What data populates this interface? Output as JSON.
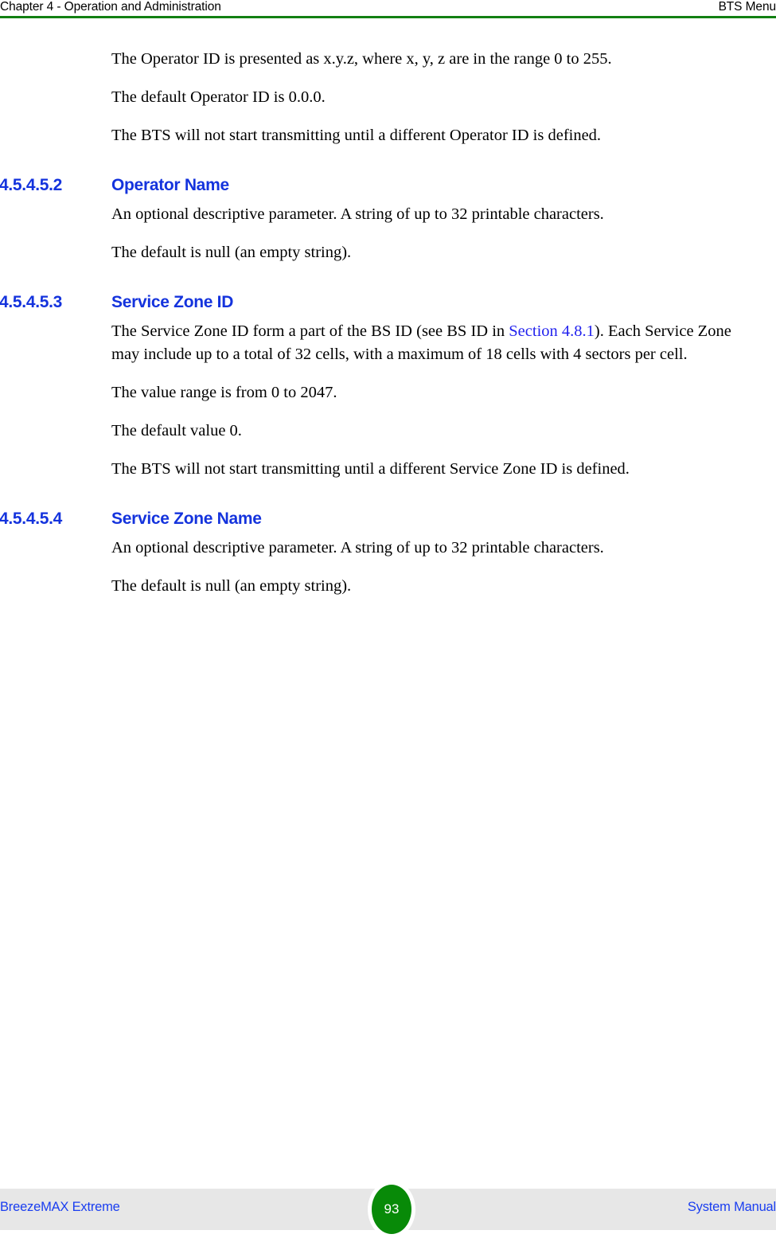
{
  "header": {
    "left": "Chapter 4 - Operation and Administration",
    "right": "BTS Menu",
    "rule_color": "#128012"
  },
  "body": {
    "intro_paragraphs": [
      "The Operator ID is presented as x.y.z, where x, y, z are in the range 0 to 255.",
      "The default Operator ID is 0.0.0.",
      "The BTS will not start transmitting until a different Operator ID is defined."
    ],
    "sections": [
      {
        "number": "4.5.4.5.2",
        "title": "Operator Name",
        "paragraphs": [
          "An optional descriptive parameter. A string of up to 32 printable characters.",
          "The default is null (an empty string)."
        ]
      },
      {
        "number": "4.5.4.5.3",
        "title": "Service Zone ID",
        "paragraph_lead": "The Service Zone ID form a part of the BS ID (see BS ID in ",
        "link_text": "Section 4.8.1",
        "paragraph_tail": "). Each Service Zone may include up to a total of 32 cells, with a maximum of 18 cells with 4 sectors per cell.",
        "paragraphs": [
          "The value range is from 0 to 2047.",
          "The default value 0.",
          "The BTS will not start transmitting until a different Service Zone ID is defined."
        ]
      },
      {
        "number": "4.5.4.5.4",
        "title": "Service Zone Name",
        "paragraphs": [
          "An optional descriptive parameter. A string of up to 32 printable characters.",
          "The default is null (an empty string)."
        ]
      }
    ]
  },
  "footer": {
    "left": "BreezeMAX Extreme",
    "right": "System Manual",
    "page_number": "93",
    "badge_color": "#088a08",
    "band_color": "#e7e7e7",
    "text_color": "#1a3ef0"
  }
}
